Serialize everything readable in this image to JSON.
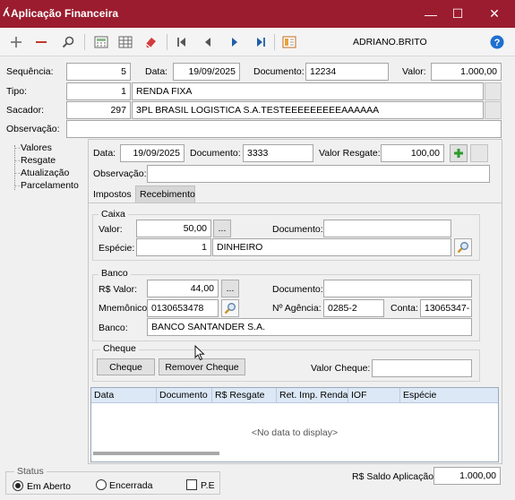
{
  "window": {
    "title": "Aplicação Financeira",
    "minimize": "—",
    "maximize": "☐",
    "close": "✕"
  },
  "toolbar": {
    "user": "ADRIANO.BRITO"
  },
  "header": {
    "sequencia_label": "Sequência:",
    "sequencia": "5",
    "data_label": "Data:",
    "data": "19/09/2025",
    "documento_label": "Documento:",
    "documento": "12234",
    "valor_label": "Valor:",
    "valor": "1.000,00",
    "tipo_label": "Tipo:",
    "tipo_code": "1",
    "tipo_name": "RENDA FIXA",
    "sacador_label": "Sacador:",
    "sacador_code": "297",
    "sacador_name": "3PL BRASIL LOGISTICA S.A.TESTEEEEEEEEEAAAAAA",
    "observacao_label": "Observação:",
    "observacao": ""
  },
  "tree": {
    "items": [
      "Valores",
      "Resgate",
      "Atualização",
      "Parcelamento"
    ]
  },
  "resgate": {
    "data_label": "Data:",
    "data": "19/09/2025",
    "documento_label": "Documento:",
    "documento": "3333",
    "valor_label": "Valor Resgate:",
    "valor": "100,00",
    "observacao_label": "Observação:",
    "observacao": ""
  },
  "tabs": [
    "Impostos",
    "Recebimento"
  ],
  "caixa": {
    "title": "Caixa",
    "valor_label": "Valor:",
    "valor": "50,00",
    "ellipsis": "...",
    "documento_label": "Documento:",
    "documento": "",
    "especie_label": "Espécie:",
    "especie_code": "1",
    "especie_name": "DINHEIRO"
  },
  "banco": {
    "title": "Banco",
    "valor_label": "R$ Valor:",
    "valor": "44,00",
    "ellipsis": "...",
    "documento_label": "Documento:",
    "documento": "",
    "mnemonico_label": "Mnemônico:",
    "mnemonico": "0130653478",
    "agencia_label": "Nº Agência:",
    "agencia": "0285-2",
    "conta_label": "Conta:",
    "conta": "13065347-",
    "banco_label": "Banco:",
    "banco_name": "BANCO SANTANDER S.A."
  },
  "cheque": {
    "title": "Cheque",
    "cheque_button": "Cheque",
    "remover_button": "Remover Cheque",
    "valor_label": "Valor Cheque:",
    "valor": ""
  },
  "grid": {
    "columns": [
      "Data",
      "Documento",
      "R$ Resgate",
      "Ret. Imp. Renda",
      "IOF",
      "Espécie"
    ],
    "empty_text": "<No data to display>"
  },
  "status": {
    "title": "Status",
    "em_aberto": "Em Aberto",
    "encerrada": "Encerrada",
    "pe": "P.E",
    "saldo_label": "R$ Saldo Aplicação:",
    "saldo": "1.000,00"
  },
  "colors": {
    "title_bar": "#9b1c2e",
    "accent_blue": "#1e5ea8",
    "add_green": "#2e9b2e",
    "remove_red": "#c0392b"
  }
}
